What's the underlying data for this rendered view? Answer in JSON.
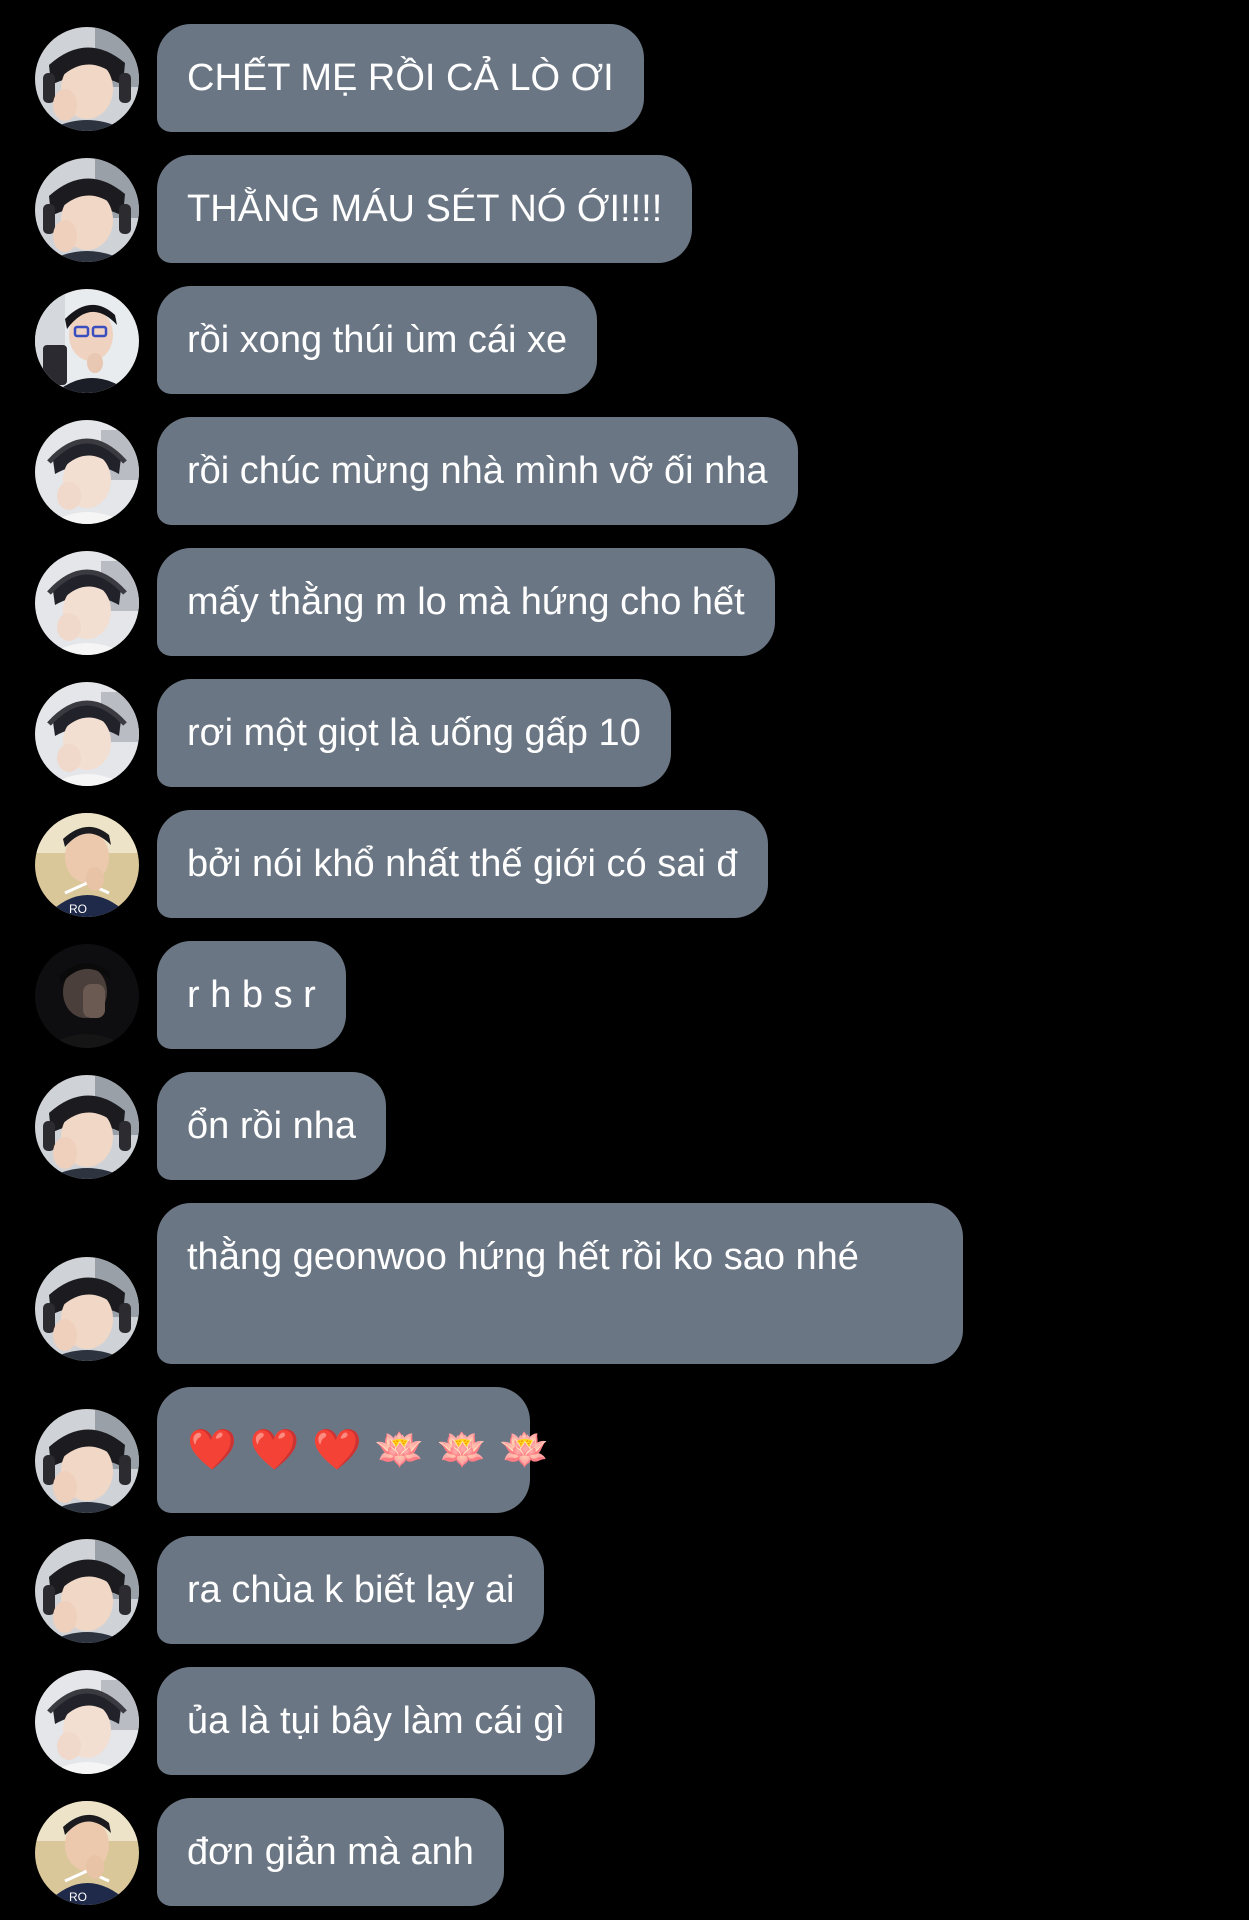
{
  "colors": {
    "background": "#000000",
    "bubble": "#6b7684",
    "text": "#ffffff"
  },
  "messages": [
    {
      "avatar": "avatar-a",
      "text": "CHẾT MẸ RỒI CẢ LÒ ƠI"
    },
    {
      "avatar": "avatar-a",
      "text": "THẰNG MÁU SÉT NÓ ỚI!!!!"
    },
    {
      "avatar": "avatar-b",
      "text": "rồi xong thúi ùm cái xe"
    },
    {
      "avatar": "avatar-c",
      "text": "rồi chúc mừng nhà mình vỡ ối nha"
    },
    {
      "avatar": "avatar-c",
      "text": "mấy thằng m lo mà hứng cho hết"
    },
    {
      "avatar": "avatar-c",
      "text": "rơi một giọt là uống gấp 10"
    },
    {
      "avatar": "avatar-d",
      "text": "bởi nói khổ nhất thế giới có sai đ"
    },
    {
      "avatar": "avatar-e",
      "text": "r h b s r"
    },
    {
      "avatar": "avatar-a",
      "text": "ổn rồi nha"
    },
    {
      "avatar": "avatar-a",
      "text": "thằng geonwoo hứng hết rồi ko sao nhé"
    },
    {
      "avatar": "avatar-a",
      "text": "❤️ ❤️ ❤️ 🪷 🪷 🪷"
    },
    {
      "avatar": "avatar-a",
      "text": "ra chùa k biết lạy ai"
    },
    {
      "avatar": "avatar-c",
      "text": "ủa là tụi bây làm cái gì"
    },
    {
      "avatar": "avatar-d",
      "text": "đơn giản mà anh"
    }
  ]
}
